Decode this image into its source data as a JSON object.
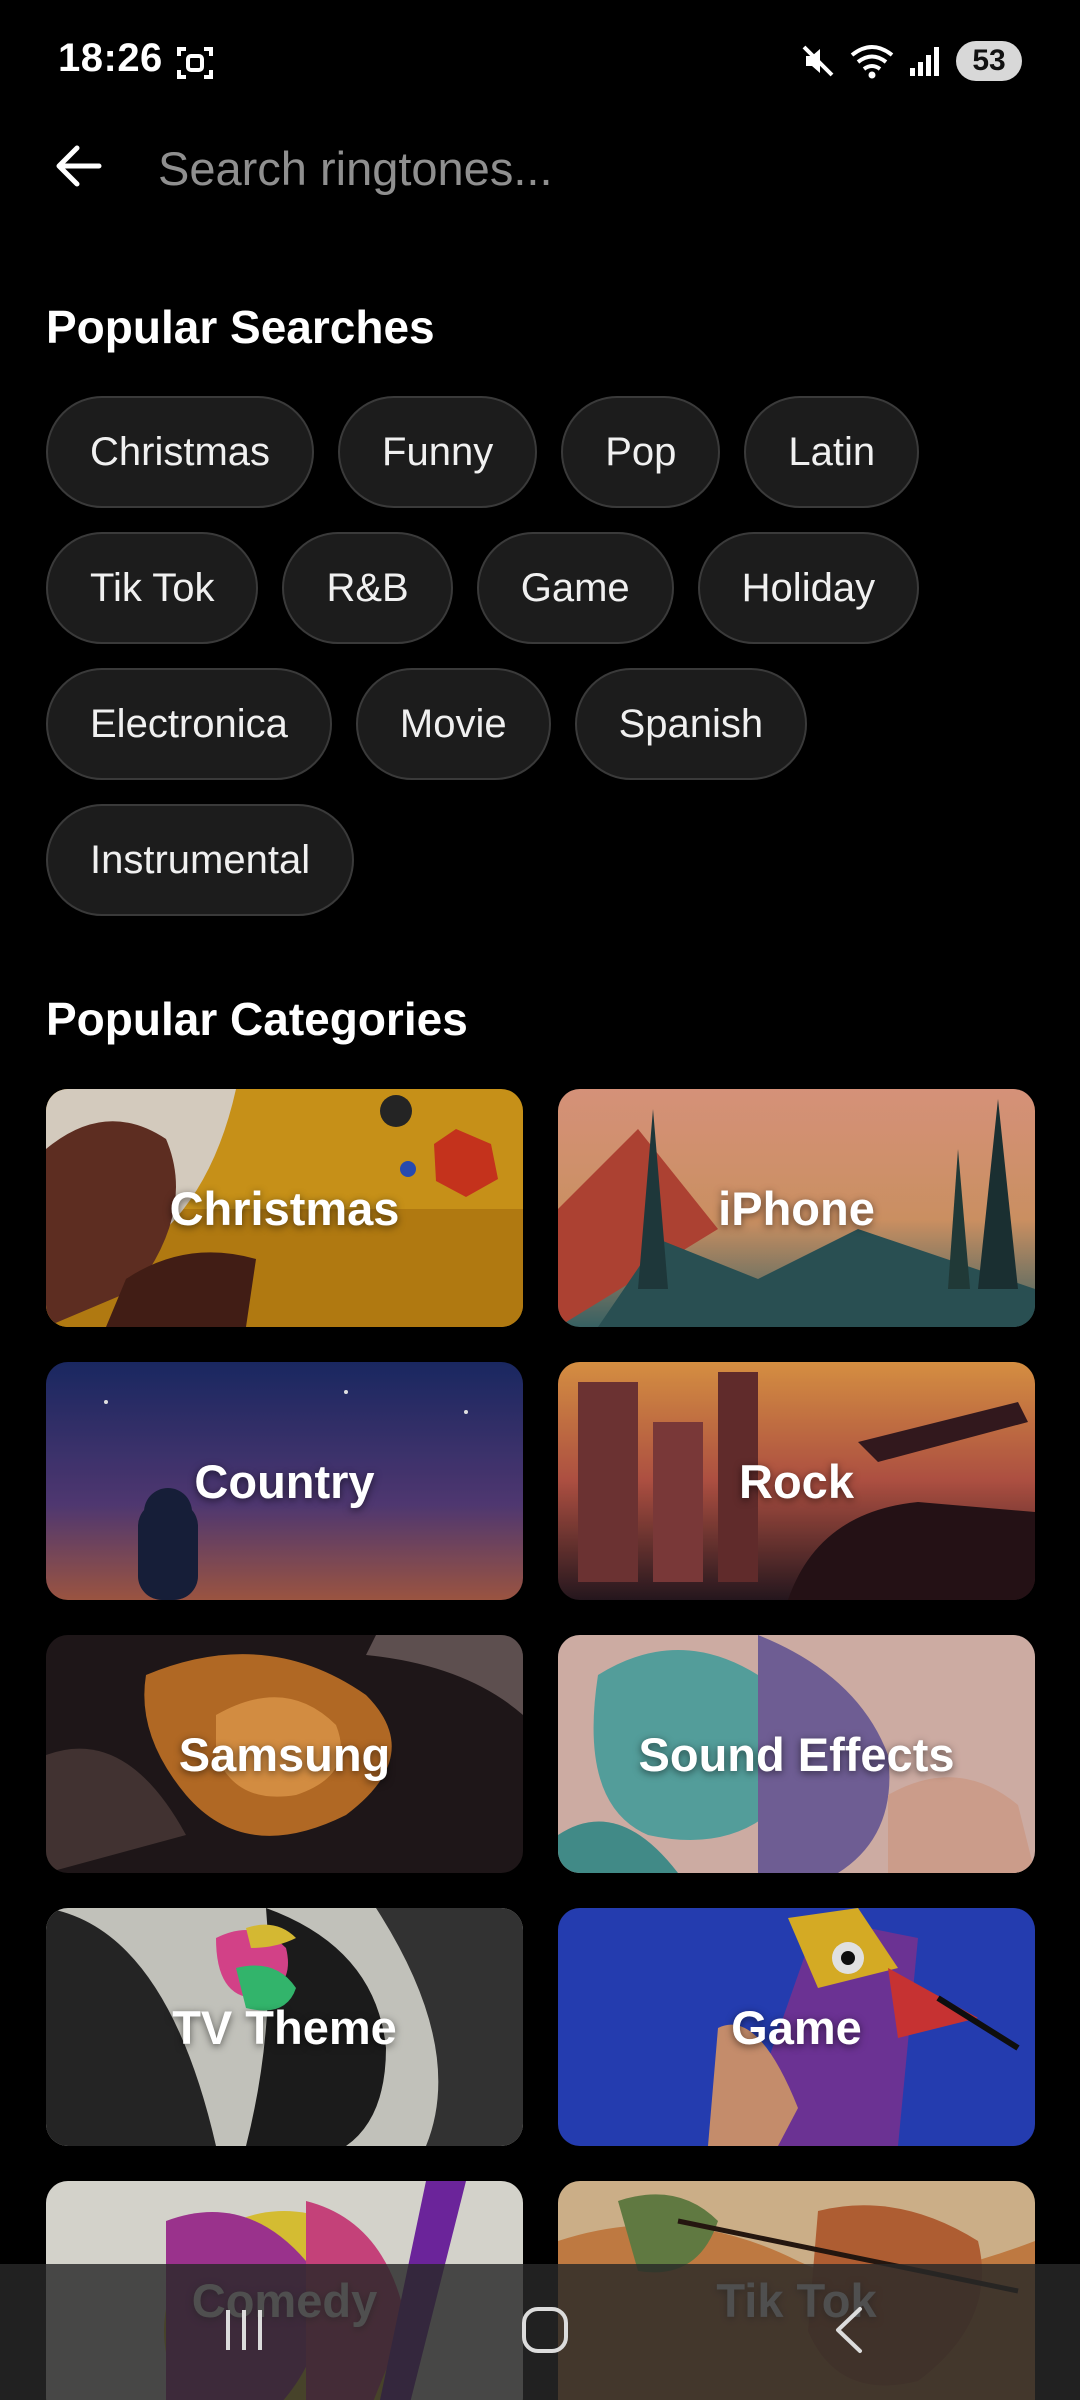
{
  "status_bar": {
    "time": "18:26",
    "battery": "53",
    "icons": [
      "screenshot-icon",
      "mute-icon",
      "wifi-icon",
      "signal-icon",
      "battery-icon"
    ]
  },
  "search": {
    "placeholder": "Search ringtones...",
    "value": ""
  },
  "popular_searches": {
    "title": "Popular Searches",
    "chips": [
      "Christmas",
      "Funny",
      "Pop",
      "Latin",
      "Tik Tok",
      "R&B",
      "Game",
      "Holiday",
      "Electronica",
      "Movie",
      "Spanish",
      "Instrumental"
    ]
  },
  "popular_categories": {
    "title": "Popular Categories",
    "cards": [
      {
        "label": "Christmas"
      },
      {
        "label": "iPhone"
      },
      {
        "label": "Country"
      },
      {
        "label": "Rock"
      },
      {
        "label": "Samsung"
      },
      {
        "label": "Sound Effects"
      },
      {
        "label": "TV Theme"
      },
      {
        "label": "Game"
      },
      {
        "label": "Comedy"
      },
      {
        "label": "Tik Tok"
      }
    ]
  },
  "nav_bar": {
    "buttons": [
      "recent-apps-icon",
      "home-icon",
      "back-icon"
    ]
  },
  "colors": {
    "background": "#000000",
    "chip_bg": "#1c1c1c",
    "chip_border": "#3a3a3a",
    "placeholder": "#8f8f8f"
  }
}
